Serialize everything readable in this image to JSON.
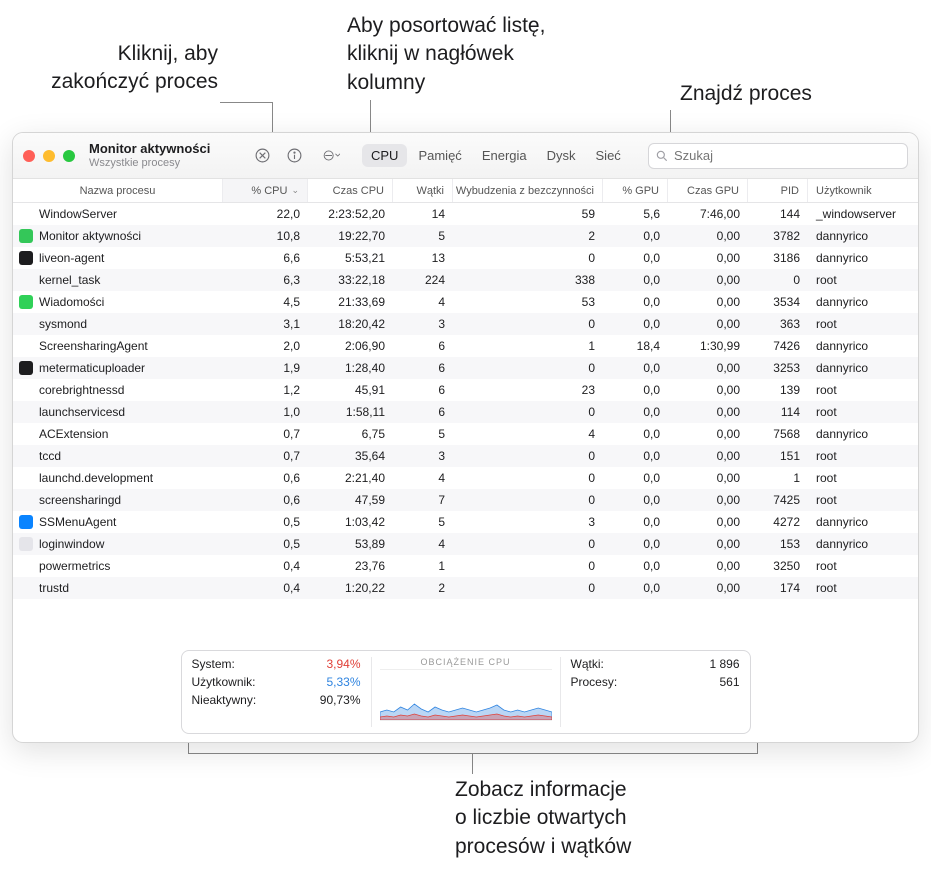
{
  "callouts": {
    "kill": "Kliknij, aby\nzakończyć proces",
    "sort": "Aby posortować listę,\nkliknij w nagłówek\nkolumny",
    "find": "Znajdź proces",
    "summary": "Zobacz informacje\no liczbie otwartych\nprocesów i wątków"
  },
  "app": {
    "title": "Monitor aktywności",
    "subtitle": "Wszystkie procesy",
    "search_placeholder": "Szukaj"
  },
  "tabs": [
    "CPU",
    "Pamięć",
    "Energia",
    "Dysk",
    "Sieć"
  ],
  "columns": [
    "Nazwa procesu",
    "% CPU",
    "Czas CPU",
    "Wątki",
    "Wybudzenia z bezczynności",
    "% GPU",
    "Czas GPU",
    "PID",
    "Użytkownik"
  ],
  "processes": [
    {
      "icon": "",
      "name": "WindowServer",
      "cpu": "22,0",
      "cput": "2:23:52,20",
      "th": "14",
      "wake": "59",
      "gpu": "5,6",
      "gput": "7:46,00",
      "pid": "144",
      "user": "_windowserver"
    },
    {
      "icon": "#34c759",
      "name": "Monitor aktywności",
      "cpu": "10,8",
      "cput": "19:22,70",
      "th": "5",
      "wake": "2",
      "gpu": "0,0",
      "gput": "0,00",
      "pid": "3782",
      "user": "dannyrico"
    },
    {
      "icon": "#1d1d1f",
      "name": "liveon-agent",
      "cpu": "6,6",
      "cput": "5:53,21",
      "th": "13",
      "wake": "0",
      "gpu": "0,0",
      "gput": "0,00",
      "pid": "3186",
      "user": "dannyrico"
    },
    {
      "icon": "",
      "name": "kernel_task",
      "cpu": "6,3",
      "cput": "33:22,18",
      "th": "224",
      "wake": "338",
      "gpu": "0,0",
      "gput": "0,00",
      "pid": "0",
      "user": "root"
    },
    {
      "icon": "#30d158",
      "name": "Wiadomości",
      "cpu": "4,5",
      "cput": "21:33,69",
      "th": "4",
      "wake": "53",
      "gpu": "0,0",
      "gput": "0,00",
      "pid": "3534",
      "user": "dannyrico"
    },
    {
      "icon": "",
      "name": "sysmond",
      "cpu": "3,1",
      "cput": "18:20,42",
      "th": "3",
      "wake": "0",
      "gpu": "0,0",
      "gput": "0,00",
      "pid": "363",
      "user": "root"
    },
    {
      "icon": "",
      "name": "ScreensharingAgent",
      "cpu": "2,0",
      "cput": "2:06,90",
      "th": "6",
      "wake": "1",
      "gpu": "18,4",
      "gput": "1:30,99",
      "pid": "7426",
      "user": "dannyrico"
    },
    {
      "icon": "#1d1d1f",
      "name": "metermaticuploader",
      "cpu": "1,9",
      "cput": "1:28,40",
      "th": "6",
      "wake": "0",
      "gpu": "0,0",
      "gput": "0,00",
      "pid": "3253",
      "user": "dannyrico"
    },
    {
      "icon": "",
      "name": "corebrightnessd",
      "cpu": "1,2",
      "cput": "45,91",
      "th": "6",
      "wake": "23",
      "gpu": "0,0",
      "gput": "0,00",
      "pid": "139",
      "user": "root"
    },
    {
      "icon": "",
      "name": "launchservicesd",
      "cpu": "1,0",
      "cput": "1:58,11",
      "th": "6",
      "wake": "0",
      "gpu": "0,0",
      "gput": "0,00",
      "pid": "114",
      "user": "root"
    },
    {
      "icon": "",
      "name": "ACExtension",
      "cpu": "0,7",
      "cput": "6,75",
      "th": "5",
      "wake": "4",
      "gpu": "0,0",
      "gput": "0,00",
      "pid": "7568",
      "user": "dannyrico"
    },
    {
      "icon": "",
      "name": "tccd",
      "cpu": "0,7",
      "cput": "35,64",
      "th": "3",
      "wake": "0",
      "gpu": "0,0",
      "gput": "0,00",
      "pid": "151",
      "user": "root"
    },
    {
      "icon": "",
      "name": "launchd.development",
      "cpu": "0,6",
      "cput": "2:21,40",
      "th": "4",
      "wake": "0",
      "gpu": "0,0",
      "gput": "0,00",
      "pid": "1",
      "user": "root"
    },
    {
      "icon": "",
      "name": "screensharingd",
      "cpu": "0,6",
      "cput": "47,59",
      "th": "7",
      "wake": "0",
      "gpu": "0,0",
      "gput": "0,00",
      "pid": "7425",
      "user": "root"
    },
    {
      "icon": "#0a84ff",
      "name": "SSMenuAgent",
      "cpu": "0,5",
      "cput": "1:03,42",
      "th": "5",
      "wake": "3",
      "gpu": "0,0",
      "gput": "0,00",
      "pid": "4272",
      "user": "dannyrico"
    },
    {
      "icon": "#e5e5ea",
      "name": "loginwindow",
      "cpu": "0,5",
      "cput": "53,89",
      "th": "4",
      "wake": "0",
      "gpu": "0,0",
      "gput": "0,00",
      "pid": "153",
      "user": "dannyrico"
    },
    {
      "icon": "",
      "name": "powermetrics",
      "cpu": "0,4",
      "cput": "23,76",
      "th": "1",
      "wake": "0",
      "gpu": "0,0",
      "gput": "0,00",
      "pid": "3250",
      "user": "root"
    },
    {
      "icon": "",
      "name": "trustd",
      "cpu": "0,4",
      "cput": "1:20,22",
      "th": "2",
      "wake": "0",
      "gpu": "0,0",
      "gput": "0,00",
      "pid": "174",
      "user": "root"
    }
  ],
  "footer": {
    "system_label": "System:",
    "system_value": "3,94%",
    "user_label": "Użytkownik:",
    "user_value": "5,33%",
    "idle_label": "Nieaktywny:",
    "idle_value": "90,73%",
    "graph_title": "OBCIĄŻENIE CPU",
    "threads_label": "Wątki:",
    "threads_value": "1 896",
    "processes_label": "Procesy:",
    "processes_value": "561"
  },
  "chart_data": {
    "type": "area",
    "title": "OBCIĄŻENIE CPU",
    "series": [
      {
        "name": "System",
        "color": "#e04038",
        "values": [
          3,
          4,
          3,
          5,
          4,
          6,
          4,
          3,
          5,
          4,
          3,
          4,
          5,
          4,
          3,
          4,
          5,
          6,
          4,
          3,
          4,
          3,
          4,
          5,
          4,
          3
        ]
      },
      {
        "name": "Użytkownik",
        "color": "#2f84e0",
        "values": [
          5,
          6,
          5,
          8,
          6,
          10,
          7,
          5,
          8,
          6,
          5,
          6,
          7,
          6,
          5,
          6,
          7,
          9,
          6,
          5,
          6,
          5,
          6,
          7,
          6,
          5
        ]
      }
    ],
    "ylim": [
      0,
      50
    ]
  }
}
